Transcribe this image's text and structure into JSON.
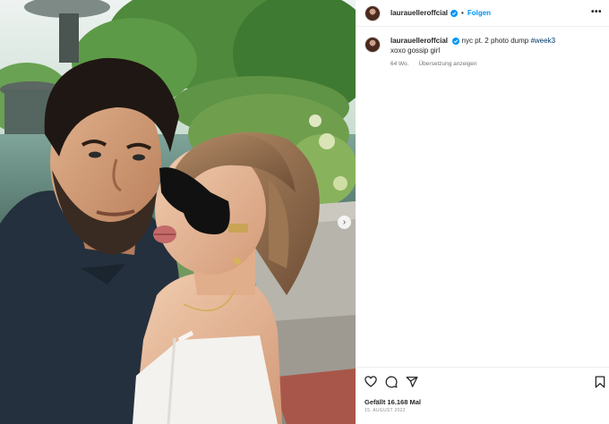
{
  "post": {
    "username": "laurauelleroffcial",
    "follow_label": "Folgen",
    "separator": "•",
    "more_label": "•••",
    "next_label": "›"
  },
  "caption": {
    "username": "laurauelleroffcial",
    "text_before_hashtag": "nyc pt. 2 photo dump",
    "hashtag": "#week3",
    "second_line": "xoxo gossip girl",
    "age": "64 Wo.",
    "translate_label": "Übersetzung anzeigen"
  },
  "footer": {
    "likes": "Gefällt 16.168 Mal",
    "date": "15. AUGUST 2022"
  },
  "icons": {
    "like": "heart-icon",
    "comment": "comment-icon",
    "share": "share-icon",
    "save": "bookmark-icon",
    "verified": "verified-badge-icon",
    "more": "more-options-icon"
  },
  "colors": {
    "accent": "#0095f6",
    "hashtag": "#00376b",
    "text": "#262626",
    "muted": "#737373"
  }
}
